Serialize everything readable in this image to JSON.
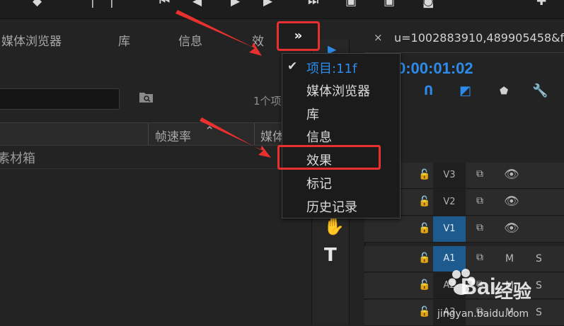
{
  "colors": {
    "accent": "#2d8ceb",
    "highlight": "#e8312f",
    "panel": "#232323",
    "menu": "#1b1b1b",
    "track_selected": "#1d5a8e"
  },
  "left_panel": {
    "tabs": [
      "媒体浏览器",
      "库",
      "信息",
      "效"
    ],
    "item_count": "1个项",
    "columns": {
      "frame_rate": "帧速率",
      "media": "媒体"
    },
    "bin_label": "素材箱"
  },
  "overflow_button": {
    "label": "»",
    "icon": "double-chevron-icon"
  },
  "menu": {
    "items": [
      {
        "label": "项目:11f",
        "checked": true
      },
      {
        "label": "媒体浏览器"
      },
      {
        "label": "库"
      },
      {
        "label": "信息"
      },
      {
        "label": "效果",
        "highlighted": true
      },
      {
        "label": "标记"
      },
      {
        "label": "历史记录"
      }
    ]
  },
  "timeline": {
    "title": "u=1002883910,489905458&fm=2",
    "close_label": "×",
    "timecode": "0:00:01:02",
    "tracks": [
      {
        "name": "V3",
        "selected": false
      },
      {
        "name": "V2",
        "selected": false
      },
      {
        "name": "V1",
        "selected": true
      },
      {
        "name": "A1",
        "selected": true,
        "m": "M",
        "s": "S"
      },
      {
        "name": "A2",
        "selected": false,
        "m": "M",
        "s": "S"
      },
      {
        "name": "A3",
        "selected": false,
        "m": "M",
        "s": "S"
      }
    ]
  },
  "tools": {
    "items": [
      "hand-tool-icon",
      "type-tool-icon"
    ]
  },
  "watermark": {
    "brand": "Bai",
    "brand2": "经验",
    "url": "jingyan.baidu.com"
  }
}
